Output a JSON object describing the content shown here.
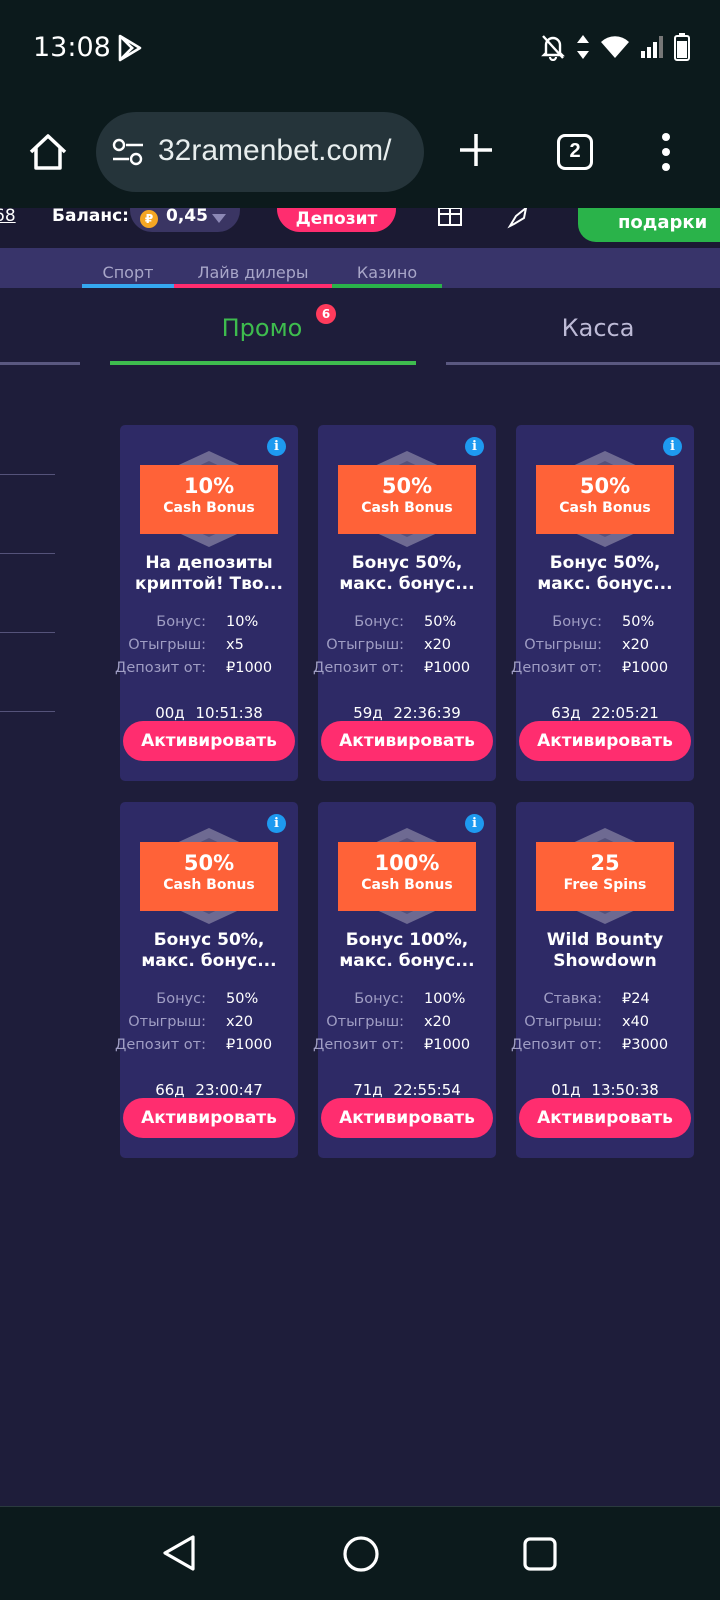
{
  "status_bar": {
    "time": "13:08"
  },
  "browser": {
    "url": "32ramenbet.com/",
    "tab_count": "2"
  },
  "site_header": {
    "left_text": "68",
    "balance_label": "Баланс:",
    "currency_symbol": "₽",
    "balance_value": "0,45",
    "deposit_label": "Депозит",
    "gifts_label": "подарки"
  },
  "categories": [
    {
      "label": "Спорт",
      "color": "#35a8f0"
    },
    {
      "label": "Лайв дилеры",
      "color": "#ff2d6f"
    },
    {
      "label": "Казино",
      "color": "#2ab34a"
    }
  ],
  "tabs": {
    "promo_label": "Промо",
    "promo_badge": "6",
    "kassa_label": "Касса"
  },
  "cards": [
    {
      "badge_big": "10%",
      "badge_small": "Cash Bonus",
      "title_line1": "На депозиты",
      "title_line2": "криптой! Тво...",
      "rows": [
        {
          "label": "Бонус:",
          "value": "10%"
        },
        {
          "label": "Отыгрыш:",
          "value": "x5"
        },
        {
          "label": "Депозит от:",
          "value": "₽1000"
        }
      ],
      "timer": "00д 10:51:38",
      "button": "Активировать"
    },
    {
      "badge_big": "50%",
      "badge_small": "Cash Bonus",
      "title_line1": "Бонус 50%,",
      "title_line2": "макс. бонус...",
      "rows": [
        {
          "label": "Бонус:",
          "value": "50%"
        },
        {
          "label": "Отыгрыш:",
          "value": "x20"
        },
        {
          "label": "Депозит от:",
          "value": "₽1000"
        }
      ],
      "timer": "59д 22:36:39",
      "button": "Активировать"
    },
    {
      "badge_big": "50%",
      "badge_small": "Cash Bonus",
      "title_line1": "Бонус 50%,",
      "title_line2": "макс. бонус...",
      "rows": [
        {
          "label": "Бонус:",
          "value": "50%"
        },
        {
          "label": "Отыгрыш:",
          "value": "x20"
        },
        {
          "label": "Депозит от:",
          "value": "₽1000"
        }
      ],
      "timer": "63д 22:05:21",
      "button": "Активировать"
    },
    {
      "badge_big": "50%",
      "badge_small": "Cash Bonus",
      "title_line1": "Бонус 50%,",
      "title_line2": "макс. бонус...",
      "rows": [
        {
          "label": "Бонус:",
          "value": "50%"
        },
        {
          "label": "Отыгрыш:",
          "value": "x20"
        },
        {
          "label": "Депозит от:",
          "value": "₽1000"
        }
      ],
      "timer": "66д 23:00:47",
      "button": "Активировать"
    },
    {
      "badge_big": "100%",
      "badge_small": "Cash Bonus",
      "title_line1": "Бонус 100%,",
      "title_line2": "макс. бонус...",
      "rows": [
        {
          "label": "Бонус:",
          "value": "100%"
        },
        {
          "label": "Отыгрыш:",
          "value": "x20"
        },
        {
          "label": "Депозит от:",
          "value": "₽1000"
        }
      ],
      "timer": "71д 22:55:54",
      "button": "Активировать"
    },
    {
      "badge_big": "25",
      "badge_small": "Free Spins",
      "title_line1": "Wild Bounty",
      "title_line2": "Showdown",
      "rows": [
        {
          "label": "Ставка:",
          "value": "₽24"
        },
        {
          "label": "Отыгрыш:",
          "value": "x40"
        },
        {
          "label": "Депозит от:",
          "value": "₽3000"
        }
      ],
      "timer": "01д 13:50:38",
      "button": "Активировать"
    }
  ]
}
